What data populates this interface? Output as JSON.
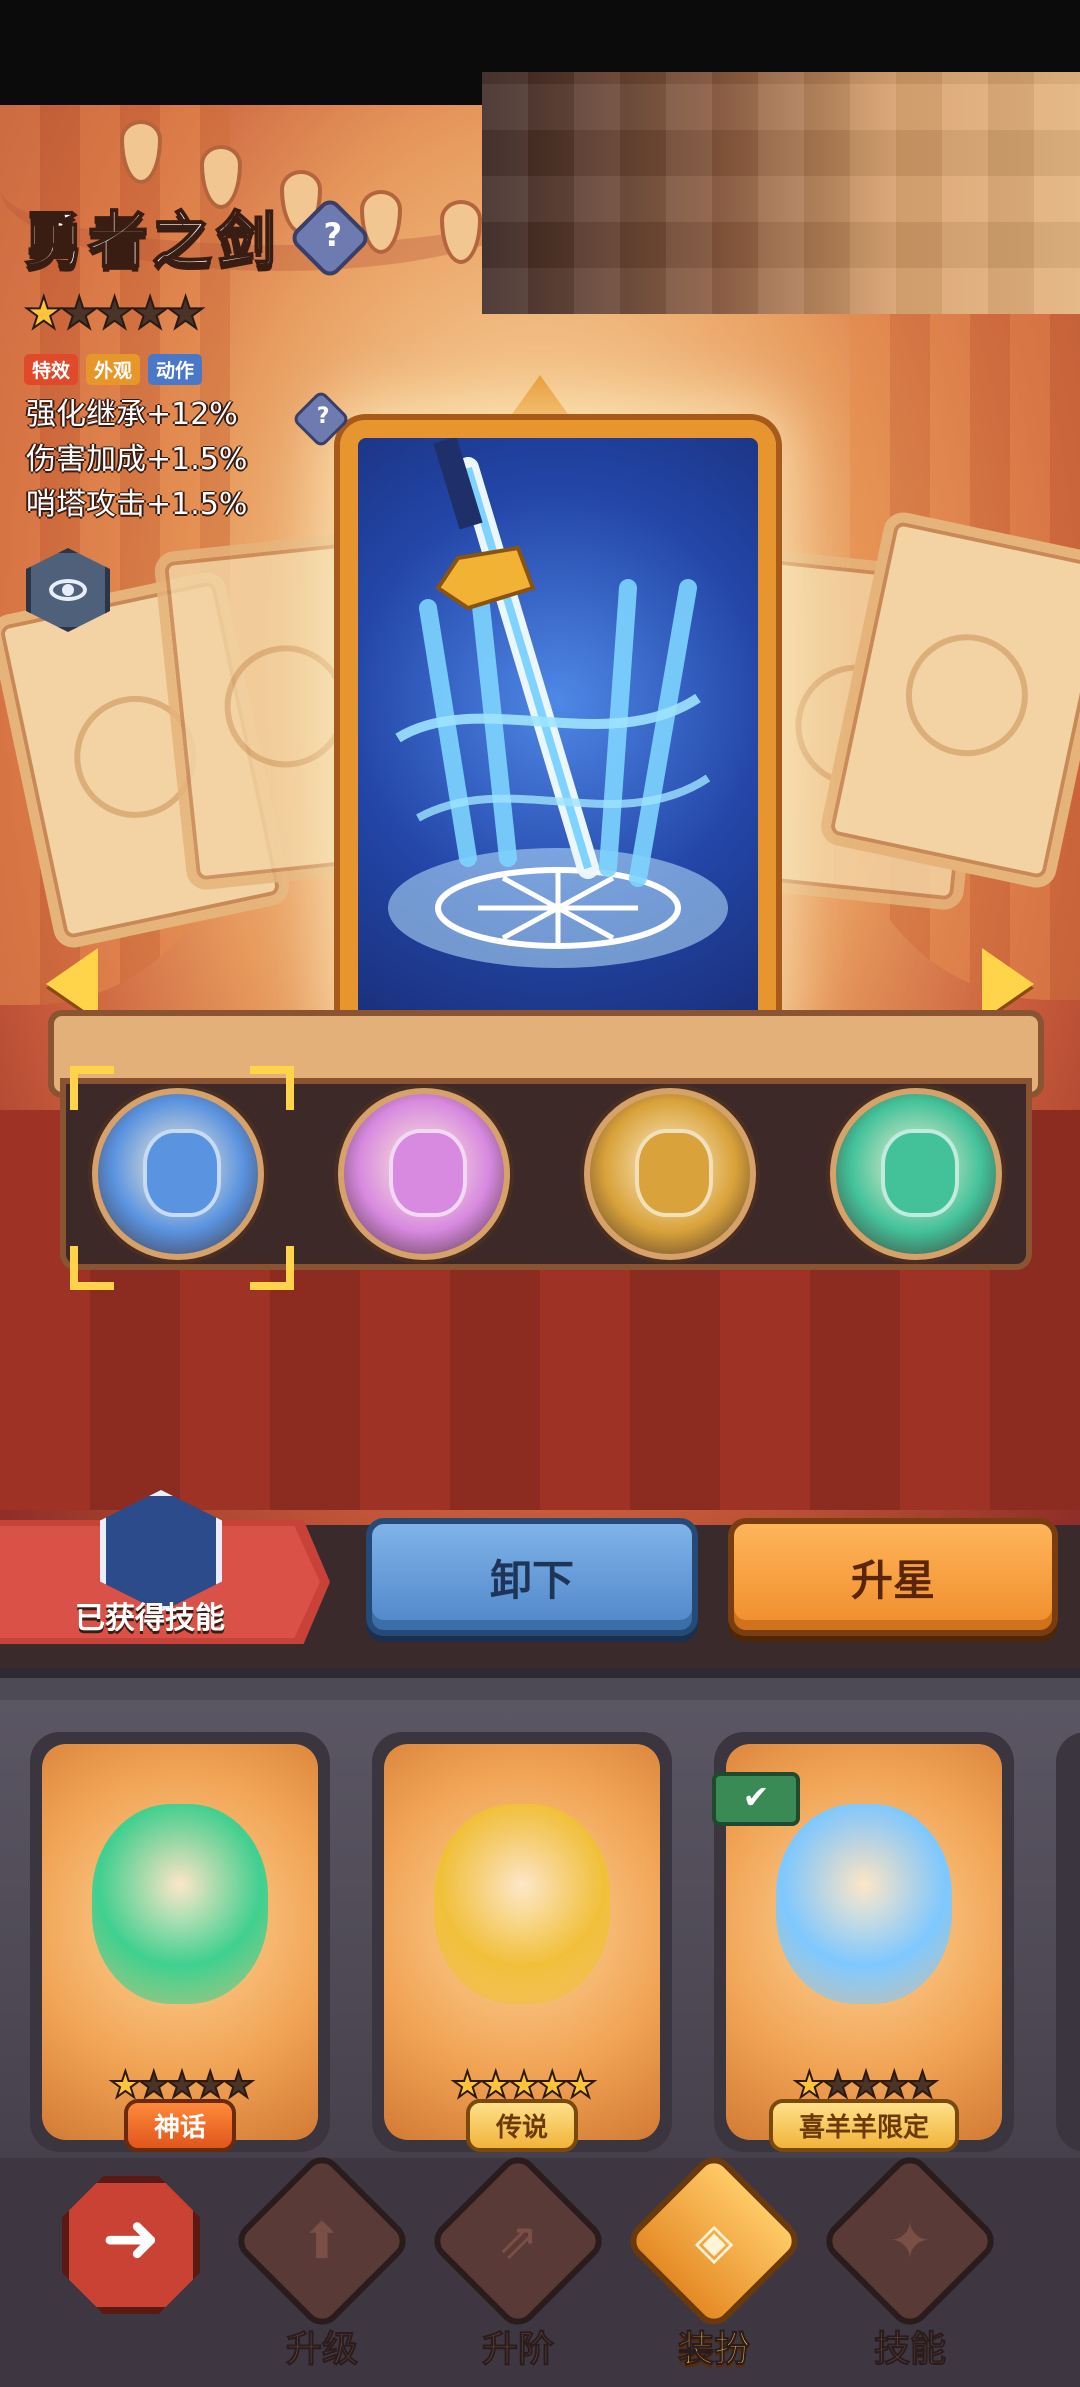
{
  "item": {
    "title": "勇者之剑",
    "stars_filled": 1,
    "stars_total": 5,
    "tags": [
      {
        "label": "特效",
        "color": "#e04a2a"
      },
      {
        "label": "外观",
        "color": "#e7962a"
      },
      {
        "label": "动作",
        "color": "#4a78c8"
      }
    ],
    "stats": [
      {
        "name": "强化继承",
        "value": "+12%"
      },
      {
        "name": "伤害加成",
        "value": "+1.5%"
      },
      {
        "name": "哨塔攻击",
        "value": "+1.5%"
      }
    ]
  },
  "icons": {
    "help": "question-icon",
    "preview": "eye-icon",
    "prev": "arrow-left-icon",
    "next": "arrow-right-icon",
    "back": "back-arrow-icon",
    "equipped": "checkmark-icon"
  },
  "skin_row": [
    {
      "name": "sword-skin",
      "theme": "#5a93e0",
      "selected": true
    },
    {
      "name": "pink-creature-skin",
      "theme": "#d889e0",
      "selected": false
    },
    {
      "name": "hammer-skin",
      "theme": "#d9a23a",
      "selected": false
    },
    {
      "name": "green-creature-skin",
      "theme": "#43c29a",
      "selected": false
    }
  ],
  "actions": {
    "skills_label": "已获得技能",
    "unequip_label": "卸下",
    "starup_label": "升星"
  },
  "inventory": [
    {
      "name": "green-creature",
      "stars_filled": 1,
      "stars_total": 5,
      "rarity": "神话",
      "rarity_style": "orange",
      "equipped": false
    },
    {
      "name": "golden-hammer",
      "stars_filled": 5,
      "stars_total": 5,
      "rarity": "传说",
      "rarity_style": "gold",
      "equipped": false
    },
    {
      "name": "hero-sword",
      "stars_filled": 1,
      "stars_total": 5,
      "rarity": "喜羊羊限定",
      "rarity_style": "limited",
      "equipped": true
    }
  ],
  "nav": {
    "items": [
      {
        "label": "升级",
        "icon": "upgrade-arrow-icon",
        "active": false
      },
      {
        "label": "升阶",
        "icon": "rank-up-icon",
        "active": false
      },
      {
        "label": "装扮",
        "icon": "outfit-icon",
        "active": true
      },
      {
        "label": "技能",
        "icon": "skill-icon",
        "active": false
      }
    ]
  }
}
